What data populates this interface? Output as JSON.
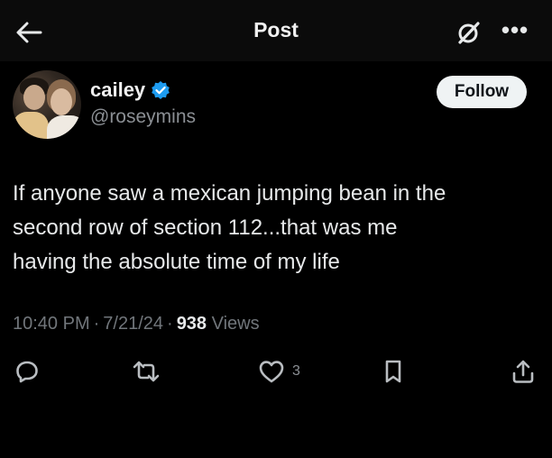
{
  "header": {
    "title": "Post",
    "back_icon": "arrow-left-icon",
    "grok_icon": "grok-icon",
    "more_label": "•••"
  },
  "author": {
    "name": "cailey",
    "handle": "@roseymins",
    "verified": true,
    "verified_color": "#1d9bf0"
  },
  "follow_button": {
    "label": "Follow"
  },
  "tweet": {
    "lines": [
      "If anyone saw a mexican jumping bean in the",
      "second row of section 112...that was me",
      "having the absolute time of my life"
    ]
  },
  "meta": {
    "time": "10:40 PM",
    "separator": "·",
    "date": "7/21/24",
    "views_count": "938",
    "views_label": "Views"
  },
  "actions": {
    "reply_icon": "reply-icon",
    "repost_icon": "repost-icon",
    "like_icon": "heart-icon",
    "like_count": "3",
    "bookmark_icon": "bookmark-icon",
    "share_icon": "share-icon"
  },
  "colors": {
    "background": "#000000",
    "text": "#e7e9ea",
    "muted": "#71767b",
    "accent": "#1d9bf0"
  }
}
